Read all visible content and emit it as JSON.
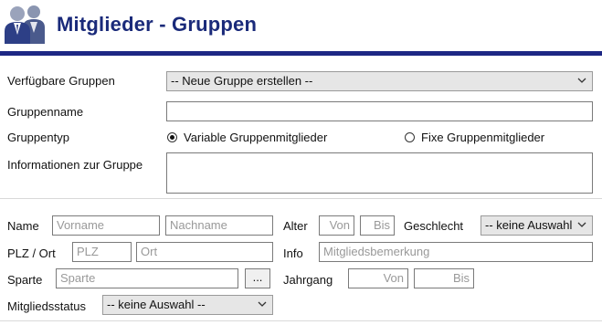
{
  "header": {
    "title": "Mitglieder - Gruppen",
    "logo": "members-group-icon",
    "accent": "#1d2784"
  },
  "group": {
    "available_label": "Verfügbare Gruppen",
    "available_value": "-- Neue Gruppe erstellen --",
    "name_label": "Gruppenname",
    "name_value": "",
    "type_label": "Gruppentyp",
    "type_option_variable": "Variable Gruppenmitglieder",
    "type_option_fixed": "Fixe Gruppenmitglieder",
    "type_selected": "variable",
    "info_label": "Informationen zur Gruppe",
    "info_value": ""
  },
  "filters": {
    "name_label": "Name",
    "firstname_placeholder": "Vorname",
    "lastname_placeholder": "Nachname",
    "age_label": "Alter",
    "age_from_placeholder": "Von",
    "age_to_placeholder": "Bis",
    "gender_label": "Geschlecht",
    "gender_value": "-- keine Auswahl",
    "zip_label": "PLZ / Ort",
    "zip_placeholder": "PLZ",
    "city_placeholder": "Ort",
    "info_label": "Info",
    "info_placeholder": "Mitgliedsbemerkung",
    "sport_label": "Sparte",
    "sport_placeholder": "Sparte",
    "sport_button": "...",
    "year_label": "Jahrgang",
    "year_from_placeholder": "Von",
    "year_to_placeholder": "Bis",
    "status_label": "Mitgliedsstatus",
    "status_value": "-- keine Auswahl --"
  }
}
